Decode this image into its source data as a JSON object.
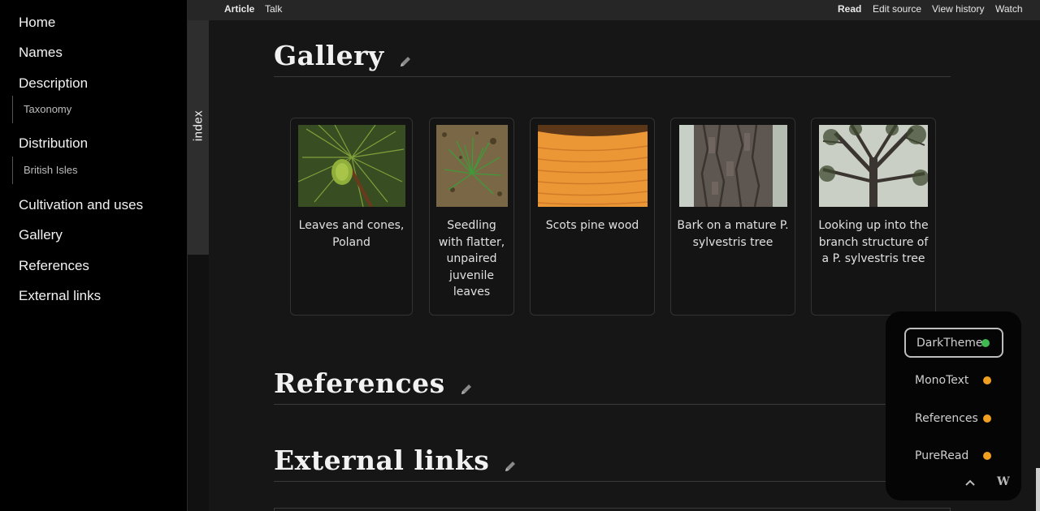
{
  "toc": {
    "items": [
      {
        "label": "Home"
      },
      {
        "label": "Names"
      },
      {
        "label": "Description"
      },
      {
        "label": "Taxonomy"
      },
      {
        "label": "Distribution"
      },
      {
        "label": "British Isles"
      },
      {
        "label": "Cultivation and uses"
      },
      {
        "label": "Gallery"
      },
      {
        "label": "References"
      },
      {
        "label": "External links"
      }
    ],
    "index_label": "index"
  },
  "topbar": {
    "article": "Article",
    "talk": "Talk",
    "read": "Read",
    "edit_source": "Edit source",
    "view_history": "View history",
    "watch": "Watch"
  },
  "sections": {
    "gallery": "Gallery",
    "references": "References",
    "external_links": "External links"
  },
  "gallery": [
    {
      "caption": "Leaves and cones, Poland",
      "icon": "pine-needles-cone-image"
    },
    {
      "caption": "Seedling with flatter, unpaired juvenile leaves",
      "icon": "seedling-image"
    },
    {
      "caption": "Scots pine wood",
      "icon": "wood-grain-image"
    },
    {
      "caption": "Bark on a mature P. sylvestris tree",
      "icon": "bark-image"
    },
    {
      "caption": "Looking up into the branch structure of a P. sylvestris tree",
      "icon": "branches-image"
    }
  ],
  "theme_panel": {
    "options": [
      {
        "label": "DarkTheme",
        "status_color": "#3fb950",
        "active": true
      },
      {
        "label": "MonoText",
        "status_color": "#f0a020",
        "active": false
      },
      {
        "label": "References",
        "status_color": "#f0a020",
        "active": false
      },
      {
        "label": "PureRead",
        "status_color": "#f0a020",
        "active": false
      }
    ],
    "logo": "W"
  },
  "colors": {
    "background": "#111111",
    "sidebar": "#000000",
    "topbar": "#262626",
    "text": "#e6e6e6"
  }
}
